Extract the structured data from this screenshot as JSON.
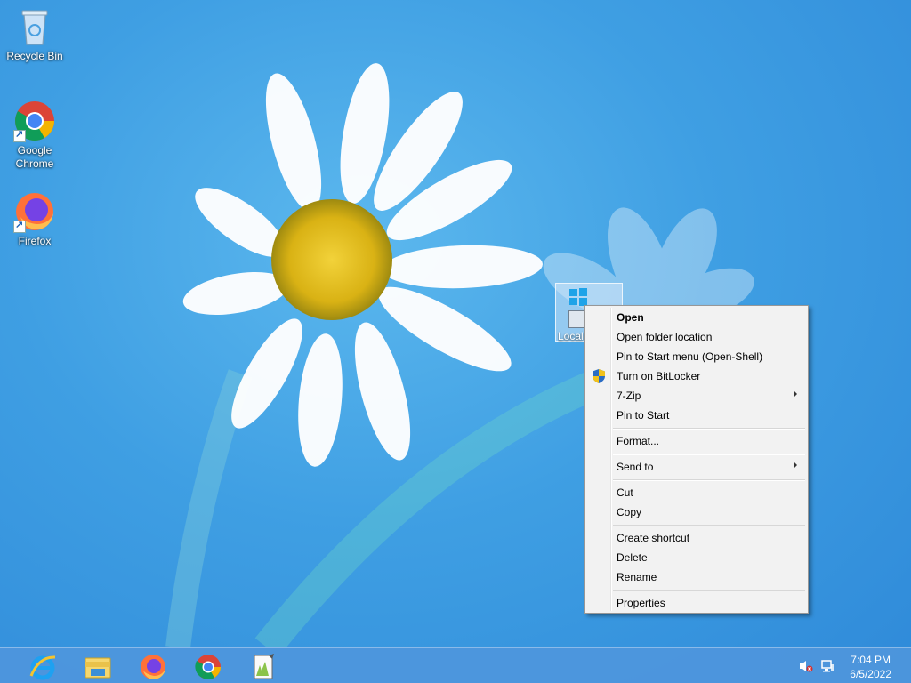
{
  "desktop": {
    "icons": [
      {
        "label": "Recycle Bin",
        "icon": "recycle-bin-icon"
      },
      {
        "label": "Google\nChrome",
        "label_line1": "Google",
        "label_line2": "Chrome",
        "icon": "chrome-icon"
      },
      {
        "label": "Firefox",
        "icon": "firefox-icon"
      }
    ],
    "selected_icon": {
      "label": "Local",
      "icon": "windows-drive-icon"
    }
  },
  "context_menu": {
    "items": [
      {
        "label": "Open",
        "bold": true
      },
      {
        "label": "Open folder location"
      },
      {
        "label": "Pin to Start menu (Open-Shell)"
      },
      {
        "label": "Turn on BitLocker",
        "icon": "uac-shield-icon"
      },
      {
        "label": "7-Zip",
        "submenu": true
      },
      {
        "label": "Pin to Start"
      },
      {
        "label": "Format..."
      },
      {
        "label": "Send to",
        "submenu": true
      },
      {
        "label": "Cut"
      },
      {
        "label": "Copy"
      },
      {
        "label": "Create shortcut"
      },
      {
        "label": "Delete"
      },
      {
        "label": "Rename"
      },
      {
        "label": "Properties"
      }
    ]
  },
  "taskbar": {
    "pinned": [
      "internet-explorer-icon",
      "file-explorer-icon",
      "firefox-icon",
      "chrome-icon",
      "notepad-plus-plus-icon"
    ],
    "tray": [
      "volume-muted-icon",
      "network-icon"
    ],
    "clock": {
      "time": "7:04 PM",
      "date": "6/5/2022"
    }
  }
}
